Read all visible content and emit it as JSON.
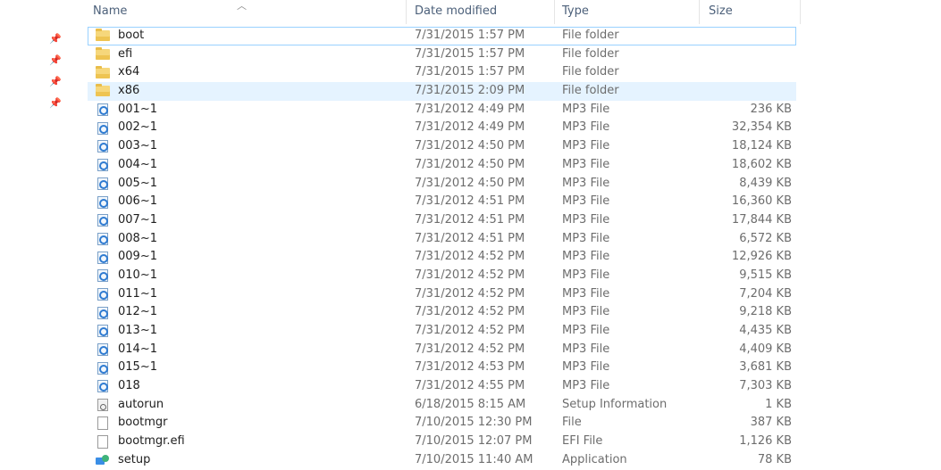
{
  "columns": {
    "name": "Name",
    "date": "Date modified",
    "type": "Type",
    "size": "Size"
  },
  "colors": {
    "selected_bg": "#e5f3ff",
    "focus_border": "#99d1ff",
    "header_text": "#4c607a"
  },
  "files": [
    {
      "name": "boot",
      "date": "7/31/2015 1:57 PM",
      "type": "File folder",
      "size": "",
      "icon": "folder-icon"
    },
    {
      "name": "efi",
      "date": "7/31/2015 1:57 PM",
      "type": "File folder",
      "size": "",
      "icon": "folder-icon"
    },
    {
      "name": "x64",
      "date": "7/31/2015 1:57 PM",
      "type": "File folder",
      "size": "",
      "icon": "folder-icon"
    },
    {
      "name": "x86",
      "date": "7/31/2015 2:09 PM",
      "type": "File folder",
      "size": "",
      "icon": "folder-icon"
    },
    {
      "name": "001~1",
      "date": "7/31/2012 4:49 PM",
      "type": "MP3 File",
      "size": "236 KB",
      "icon": "mp3-icon"
    },
    {
      "name": "002~1",
      "date": "7/31/2012 4:49 PM",
      "type": "MP3 File",
      "size": "32,354 KB",
      "icon": "mp3-icon"
    },
    {
      "name": "003~1",
      "date": "7/31/2012 4:50 PM",
      "type": "MP3 File",
      "size": "18,124 KB",
      "icon": "mp3-icon"
    },
    {
      "name": "004~1",
      "date": "7/31/2012 4:50 PM",
      "type": "MP3 File",
      "size": "18,602 KB",
      "icon": "mp3-icon"
    },
    {
      "name": "005~1",
      "date": "7/31/2012 4:50 PM",
      "type": "MP3 File",
      "size": "8,439 KB",
      "icon": "mp3-icon"
    },
    {
      "name": "006~1",
      "date": "7/31/2012 4:51 PM",
      "type": "MP3 File",
      "size": "16,360 KB",
      "icon": "mp3-icon"
    },
    {
      "name": "007~1",
      "date": "7/31/2012 4:51 PM",
      "type": "MP3 File",
      "size": "17,844 KB",
      "icon": "mp3-icon"
    },
    {
      "name": "008~1",
      "date": "7/31/2012 4:51 PM",
      "type": "MP3 File",
      "size": "6,572 KB",
      "icon": "mp3-icon"
    },
    {
      "name": "009~1",
      "date": "7/31/2012 4:52 PM",
      "type": "MP3 File",
      "size": "12,926 KB",
      "icon": "mp3-icon"
    },
    {
      "name": "010~1",
      "date": "7/31/2012 4:52 PM",
      "type": "MP3 File",
      "size": "9,515 KB",
      "icon": "mp3-icon"
    },
    {
      "name": "011~1",
      "date": "7/31/2012 4:52 PM",
      "type": "MP3 File",
      "size": "7,204 KB",
      "icon": "mp3-icon"
    },
    {
      "name": "012~1",
      "date": "7/31/2012 4:52 PM",
      "type": "MP3 File",
      "size": "9,218 KB",
      "icon": "mp3-icon"
    },
    {
      "name": "013~1",
      "date": "7/31/2012 4:52 PM",
      "type": "MP3 File",
      "size": "4,435 KB",
      "icon": "mp3-icon"
    },
    {
      "name": "014~1",
      "date": "7/31/2012 4:52 PM",
      "type": "MP3 File",
      "size": "4,409 KB",
      "icon": "mp3-icon"
    },
    {
      "name": "015~1",
      "date": "7/31/2012 4:53 PM",
      "type": "MP3 File",
      "size": "3,681 KB",
      "icon": "mp3-icon"
    },
    {
      "name": "018",
      "date": "7/31/2012 4:55 PM",
      "type": "MP3 File",
      "size": "7,303 KB",
      "icon": "mp3-icon"
    },
    {
      "name": "autorun",
      "date": "6/18/2015 8:15 AM",
      "type": "Setup Information",
      "size": "1 KB",
      "icon": "setup-info-icon"
    },
    {
      "name": "bootmgr",
      "date": "7/10/2015 12:30 PM",
      "type": "File",
      "size": "387 KB",
      "icon": "file-icon"
    },
    {
      "name": "bootmgr.efi",
      "date": "7/10/2015 12:07 PM",
      "type": "EFI File",
      "size": "1,126 KB",
      "icon": "file-icon"
    },
    {
      "name": "setup",
      "date": "7/10/2015 11:40 AM",
      "type": "Application",
      "size": "78 KB",
      "icon": "application-icon"
    }
  ],
  "selection": {
    "focused": "boot",
    "selected": "x86"
  }
}
